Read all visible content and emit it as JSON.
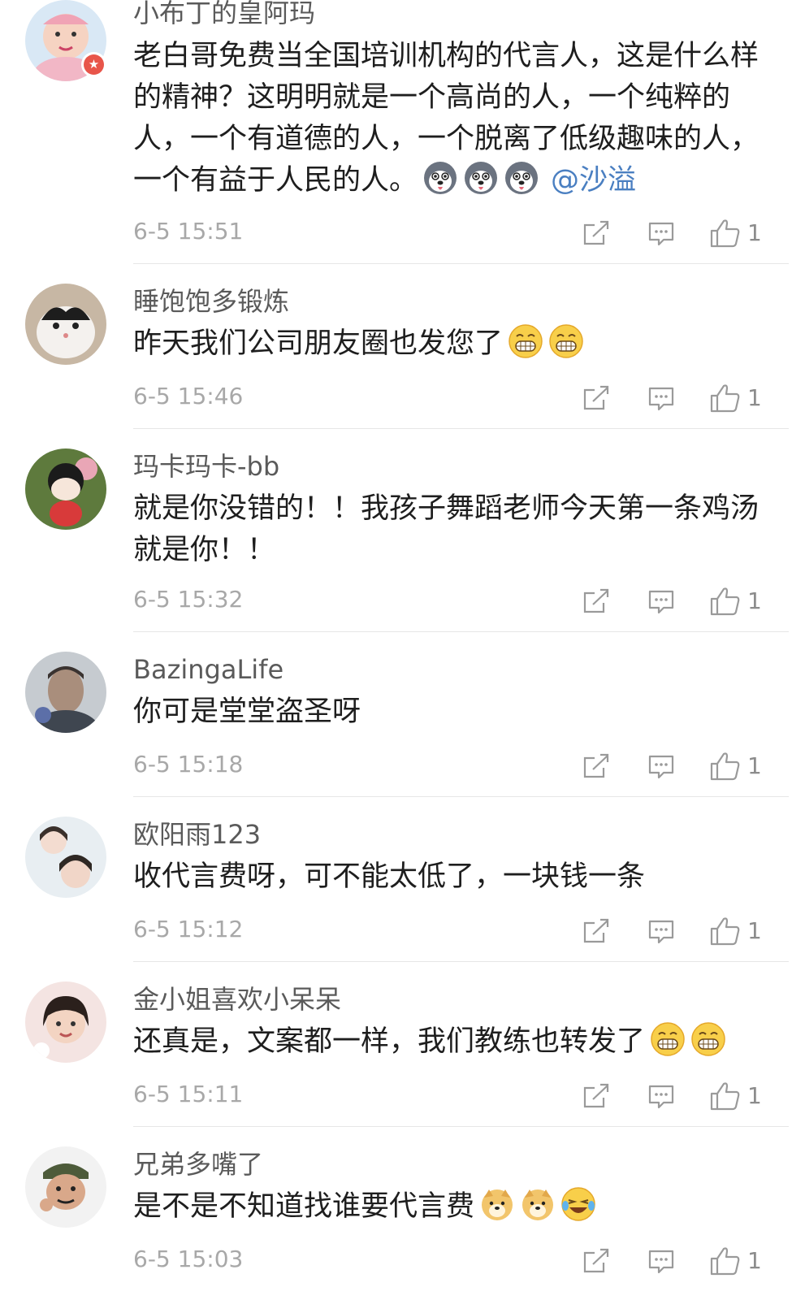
{
  "colors": {
    "username": "#5a5a5a",
    "body_text": "#1e1e1e",
    "timestamp": "#a8a8a8",
    "icon": "#9a9a9a",
    "mention": "#4a7fc1",
    "divider": "#e6e6e6",
    "badge": "#e8554a"
  },
  "comments": [
    {
      "username": "小布丁的皇阿玛",
      "avatar_icon": "baby-photo-avatar",
      "verified_badge": "★",
      "text": "老白哥免费当全国培训机构的代言人，这是什么样的精神？这明明就是一个高尚的人，一个纯粹的人，一个有道德的人，一个脱离了低级趣味的人，一个有益于人民的人。",
      "emojis": [
        "husky-emoji",
        "husky-emoji",
        "husky-emoji"
      ],
      "mention": "@沙溢",
      "time": "6-5 15:51",
      "likes": "1"
    },
    {
      "username": "睡饱饱多锻炼",
      "avatar_icon": "cat-photo-avatar",
      "text": "昨天我们公司朋友圈也发您了",
      "emojis": [
        "grin-emoji",
        "grin-emoji"
      ],
      "time": "6-5 15:46",
      "likes": "1"
    },
    {
      "username": "玛卡玛卡-bb",
      "avatar_icon": "doll-photo-avatar",
      "text": "就是你没错的！！我孩子舞蹈老师今天第一条鸡汤就是你！！",
      "emojis": [],
      "time": "6-5 15:32",
      "likes": "1"
    },
    {
      "username": "BazingaLife",
      "avatar_icon": "portrait-photo-avatar",
      "text": "你可是堂堂盗圣呀",
      "emojis": [],
      "time": "6-5 15:18",
      "likes": "1"
    },
    {
      "username": "欧阳雨123",
      "avatar_icon": "girl-photo-avatar",
      "text": "收代言费呀，可不能太低了，一块钱一条",
      "emojis": [],
      "time": "6-5 15:12",
      "likes": "1"
    },
    {
      "username": "金小姐喜欢小呆呆",
      "avatar_icon": "child-photo-avatar",
      "text": "还真是，文案都一样，我们教练也转发了",
      "emojis": [
        "grin-emoji",
        "grin-emoji"
      ],
      "time": "6-5 15:11",
      "likes": "1"
    },
    {
      "username": "兄弟多嘴了",
      "avatar_icon": "cartoon-soldier-avatar",
      "text": "是不是不知道找谁要代言费",
      "emojis": [
        "doge-emoji",
        "doge-emoji",
        "laugh-cry-emoji"
      ],
      "time": "6-5 15:03",
      "likes": "1"
    }
  ]
}
